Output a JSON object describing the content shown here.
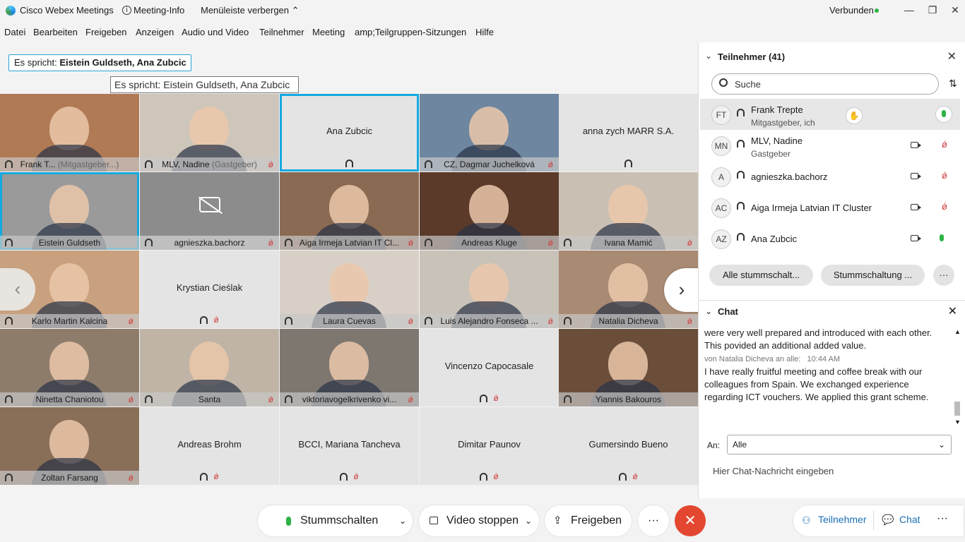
{
  "titlebar": {
    "app_name": "Cisco Webex Meetings",
    "meeting_info": "Meeting-Info",
    "hide_menu": "Menüleiste verbergen",
    "status": "Verbunden",
    "status_color": "#2fb344"
  },
  "menu": [
    "Datei",
    "Bearbeiten",
    "Freigeben",
    "Anzeigen",
    "Audio und Video",
    "Teilnehmer",
    "Meeting",
    "amp;Teilgruppen-Sitzungen",
    "Hilfe"
  ],
  "speaking": {
    "prefix": "Es spricht:",
    "names": "Eistein Guldseth, Ana Zubcic",
    "tooltip": "Es spricht: Eistein Guldseth, Ana Zubcic"
  },
  "tiles": [
    {
      "name": "Frank T...",
      "sub": "(Mitgastgeber...)",
      "video": true,
      "muted": false,
      "sel": false,
      "bg": "#b07a55"
    },
    {
      "name": "MLV, Nadine",
      "sub": "(Gastgeber)",
      "video": true,
      "muted": true,
      "sel": false,
      "bg": "#cfc6bb"
    },
    {
      "name": "Ana Zubcic",
      "video": false,
      "muted": false,
      "sel": true,
      "bg": "#e4e4e4"
    },
    {
      "name": "CZ, Dagmar Juchelková",
      "video": true,
      "muted": true,
      "sel": false,
      "bg": "#6e86a0"
    },
    {
      "name": "anna zych MARR S.A.",
      "video": false,
      "muted": false,
      "sel": false,
      "bg": "#e4e4e4"
    },
    {
      "name": "Eistein Guldseth",
      "video": true,
      "muted": false,
      "sel": true,
      "bg": "#9a9a9a"
    },
    {
      "name": "agnieszka.bachorz",
      "video": "off",
      "muted": true,
      "sel": false,
      "bg": "#8c8c8c"
    },
    {
      "name": "Aiga Irmeja Latvian IT Cl...",
      "video": true,
      "muted": true,
      "sel": false,
      "bg": "#8a6a52"
    },
    {
      "name": "Andreas Kluge",
      "video": true,
      "muted": true,
      "sel": false,
      "bg": "#5b3a2a"
    },
    {
      "name": "Ivana Mamić",
      "video": true,
      "muted": true,
      "sel": false,
      "bg": "#c9bfb3"
    },
    {
      "name": "Karlo Martin Kalcina",
      "video": true,
      "muted": true,
      "sel": false,
      "bg": "#c9a17f"
    },
    {
      "name": "Krystian Cieślak",
      "video": false,
      "muted": true,
      "sel": false,
      "bg": "#e4e4e4"
    },
    {
      "name": "Laura Cuevas",
      "video": true,
      "muted": true,
      "sel": false,
      "bg": "#d8d0c7"
    },
    {
      "name": "Luis Alejandro Fonseca ...",
      "video": true,
      "muted": true,
      "sel": false,
      "bg": "#c8c2b8"
    },
    {
      "name": "Natalia Dicheva",
      "video": true,
      "muted": true,
      "sel": false,
      "bg": "#a98a73"
    },
    {
      "name": "Ninetta Chaniotou",
      "video": true,
      "muted": true,
      "sel": false,
      "bg": "#8e7c6b"
    },
    {
      "name": "Santa",
      "video": true,
      "muted": true,
      "sel": false,
      "bg": "#bfb4a6"
    },
    {
      "name": "viktoriavogelkrivenko vi...",
      "video": true,
      "muted": true,
      "sel": false,
      "bg": "#7d7770"
    },
    {
      "name": "Vincenzo Capocasale",
      "video": false,
      "muted": true,
      "sel": false,
      "bg": "#e4e4e4"
    },
    {
      "name": "Yiannis Bakouros",
      "video": true,
      "muted": false,
      "sel": false,
      "bg": "#6b4e3a"
    },
    {
      "name": "Zoltan Farsang",
      "video": true,
      "muted": true,
      "sel": false,
      "bg": "#8a6f58"
    },
    {
      "name": "Andreas Brohm",
      "video": false,
      "muted": true,
      "sel": false,
      "bg": "#e4e4e4"
    },
    {
      "name": "BCCI, Mariana Tancheva",
      "video": false,
      "muted": true,
      "sel": false,
      "bg": "#e4e4e4"
    },
    {
      "name": "Dimitar Paunov",
      "video": false,
      "muted": true,
      "sel": false,
      "bg": "#e4e4e4"
    },
    {
      "name": "Gumersindo Bueno",
      "video": false,
      "muted": true,
      "sel": false,
      "bg": "#e4e4e4"
    }
  ],
  "participants_panel": {
    "title": "Teilnehmer (41)",
    "search_placeholder": "Suche",
    "rows": [
      {
        "initials": "FT",
        "name": "Frank Trepte",
        "role": "Mitgastgeber, ich"
      },
      {
        "initials": "MN",
        "name": "MLV, Nadine",
        "role": "Gastgeber"
      },
      {
        "initials": "A",
        "name": "agnieszka.bachorz",
        "role": ""
      },
      {
        "initials": "AC",
        "name": "Aiga Irmeja Latvian IT Cluster",
        "role": ""
      },
      {
        "initials": "AZ",
        "name": "Ana Zubcic",
        "role": ""
      }
    ],
    "mute_all": "Alle stummschalt...",
    "unmute": "Stummschaltung ...",
    "more": "···"
  },
  "chat": {
    "title": "Chat",
    "line1": "were very well prepared and introduced with each other.",
    "line2": "This povided an additional added value.",
    "meta": "von Natalia Dicheva an alle:",
    "time": "10:44 AM",
    "msg": "I have really fruitful meeting and coffee break with our colleagues from Spain. We exchanged experience regarding ICT vouchers. We applied this grant scheme.",
    "to_label": "An:",
    "to_value": "Alle",
    "input_placeholder": "Hier Chat-Nachricht eingeben"
  },
  "bottom": {
    "mute": "Stummschalten",
    "video": "Video stoppen",
    "share": "Freigeben",
    "more": "···",
    "participants": "Teilnehmer",
    "chat": "Chat",
    "end_color": "#e3472f"
  }
}
